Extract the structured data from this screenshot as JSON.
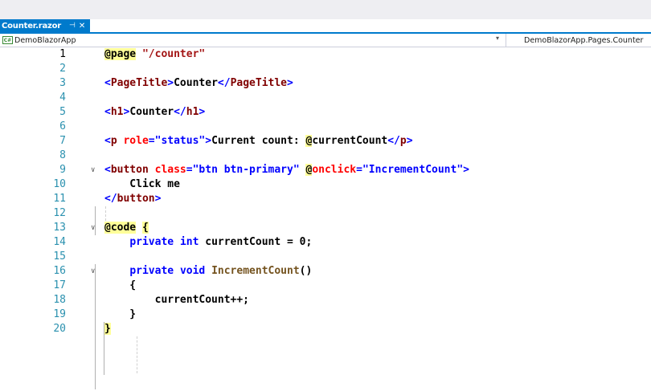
{
  "tab": {
    "title": "Counter.razor",
    "pin_glyph": "⊣",
    "close_glyph": "✕"
  },
  "navbar": {
    "project_icon": "C#",
    "project": "DemoBlazorApp",
    "member": "DemoBlazorApp.Pages.Counter"
  },
  "editor": {
    "lines": [
      {
        "n": "1",
        "current": true,
        "parts": [
          [
            "razor",
            "@page"
          ],
          [
            "plain",
            " "
          ],
          [
            "str",
            "\"/counter\""
          ]
        ]
      },
      {
        "n": "2",
        "parts": []
      },
      {
        "n": "3",
        "parts": [
          [
            "br",
            "<"
          ],
          [
            "tag",
            "PageTitle"
          ],
          [
            "br",
            ">"
          ],
          [
            "plain",
            "Counter"
          ],
          [
            "br",
            "</"
          ],
          [
            "tag",
            "PageTitle"
          ],
          [
            "br",
            ">"
          ]
        ]
      },
      {
        "n": "4",
        "parts": []
      },
      {
        "n": "5",
        "parts": [
          [
            "br",
            "<"
          ],
          [
            "tag",
            "h1"
          ],
          [
            "br",
            ">"
          ],
          [
            "plain",
            "Counter"
          ],
          [
            "br",
            "</"
          ],
          [
            "tag",
            "h1"
          ],
          [
            "br",
            ">"
          ]
        ]
      },
      {
        "n": "6",
        "parts": []
      },
      {
        "n": "7",
        "parts": [
          [
            "br",
            "<"
          ],
          [
            "tag",
            "p"
          ],
          [
            "plain",
            " "
          ],
          [
            "attr",
            "role"
          ],
          [
            "br",
            "="
          ],
          [
            "attrv",
            "\"status\""
          ],
          [
            "br",
            ">"
          ],
          [
            "plain",
            "Current count: "
          ],
          [
            "razor",
            "@"
          ],
          [
            "plain",
            "currentCount"
          ],
          [
            "br",
            "</"
          ],
          [
            "tag",
            "p"
          ],
          [
            "br",
            ">"
          ]
        ]
      },
      {
        "n": "8",
        "parts": []
      },
      {
        "n": "9",
        "fold": "open",
        "parts": [
          [
            "br",
            "<"
          ],
          [
            "tag",
            "button"
          ],
          [
            "plain",
            " "
          ],
          [
            "attr",
            "class"
          ],
          [
            "br",
            "="
          ],
          [
            "attrv",
            "\"btn btn-primary\""
          ],
          [
            "plain",
            " "
          ],
          [
            "razor",
            "@"
          ],
          [
            "attr",
            "onclick"
          ],
          [
            "br",
            "="
          ],
          [
            "attrv",
            "\"IncrementCount\""
          ],
          [
            "br",
            ">"
          ]
        ]
      },
      {
        "n": "10",
        "parts": [
          [
            "plain",
            "    Click me"
          ]
        ]
      },
      {
        "n": "11",
        "parts": [
          [
            "br",
            "</"
          ],
          [
            "tag",
            "button"
          ],
          [
            "br",
            ">"
          ]
        ]
      },
      {
        "n": "12",
        "parts": []
      },
      {
        "n": "13",
        "fold": "open",
        "parts": [
          [
            "razor",
            "@code"
          ],
          [
            "plain",
            " "
          ],
          [
            "razor",
            "{"
          ]
        ]
      },
      {
        "n": "14",
        "parts": [
          [
            "plain",
            "    "
          ],
          [
            "kw",
            "private"
          ],
          [
            "plain",
            " "
          ],
          [
            "kw",
            "int"
          ],
          [
            "plain",
            " currentCount = 0;"
          ]
        ]
      },
      {
        "n": "15",
        "parts": []
      },
      {
        "n": "16",
        "fold": "open",
        "parts": [
          [
            "plain",
            "    "
          ],
          [
            "kw",
            "private"
          ],
          [
            "plain",
            " "
          ],
          [
            "kw",
            "void"
          ],
          [
            "plain",
            " "
          ],
          [
            "method",
            "IncrementCount"
          ],
          [
            "plain",
            "()"
          ]
        ]
      },
      {
        "n": "17",
        "parts": [
          [
            "plain",
            "    {"
          ]
        ]
      },
      {
        "n": "18",
        "parts": [
          [
            "plain",
            "        currentCount++;"
          ]
        ]
      },
      {
        "n": "19",
        "parts": [
          [
            "plain",
            "    }"
          ]
        ]
      },
      {
        "n": "20",
        "parts": [
          [
            "razor",
            "}"
          ]
        ]
      }
    ]
  }
}
